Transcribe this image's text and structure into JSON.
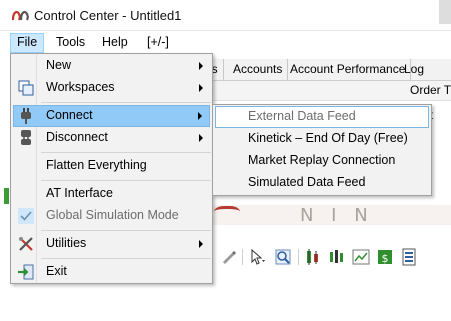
{
  "window": {
    "title": "Control Center - Untitled1",
    "logo": "ninjatrader-logo"
  },
  "menubar": {
    "items": [
      {
        "label": "File",
        "active": true
      },
      {
        "label": "Tools",
        "active": false
      },
      {
        "label": "Help",
        "active": false
      },
      {
        "label": "[+/-]",
        "active": false
      }
    ]
  },
  "background": {
    "tabs": [
      "ns",
      "Accounts",
      "Account Performance",
      "Log"
    ],
    "order_label": "Order T",
    "column_fragment": "t",
    "splash_fragment": "N I N"
  },
  "file_menu": {
    "items": [
      {
        "label": "New",
        "icon": "",
        "submenu": true,
        "enabled": true
      },
      {
        "label": "Workspaces",
        "icon": "workspaces-icon",
        "submenu": true,
        "enabled": true
      },
      {
        "label": "Connect",
        "icon": "connect-plug-icon",
        "submenu": true,
        "enabled": true,
        "highlighted": true
      },
      {
        "label": "Disconnect",
        "icon": "disconnect-plug-icon",
        "submenu": true,
        "enabled": true
      },
      {
        "label": "Flatten Everything",
        "icon": "",
        "submenu": false,
        "enabled": true
      },
      {
        "label": "AT Interface",
        "icon": "",
        "submenu": false,
        "enabled": true
      },
      {
        "label": "Global Simulation Mode",
        "icon": "checkmark-icon",
        "submenu": false,
        "enabled": false
      },
      {
        "label": "Utilities",
        "icon": "utilities-tools-icon",
        "submenu": true,
        "enabled": true
      },
      {
        "label": "Exit",
        "icon": "exit-icon",
        "submenu": false,
        "enabled": true
      }
    ]
  },
  "connect_submenu": {
    "items": [
      {
        "label": "External Data Feed",
        "enabled": false,
        "hover": true
      },
      {
        "label": "Kinetick – End Of Day (Free)",
        "enabled": true
      },
      {
        "label": "Market Replay Connection",
        "enabled": true
      },
      {
        "label": "Simulated Data Feed",
        "enabled": true
      }
    ]
  },
  "colors": {
    "menu_highlight": "#91c9f7",
    "menubar_active": "#cce8ff",
    "menu_background": "#f2f2f2",
    "disabled_text": "#6d6d6d"
  }
}
